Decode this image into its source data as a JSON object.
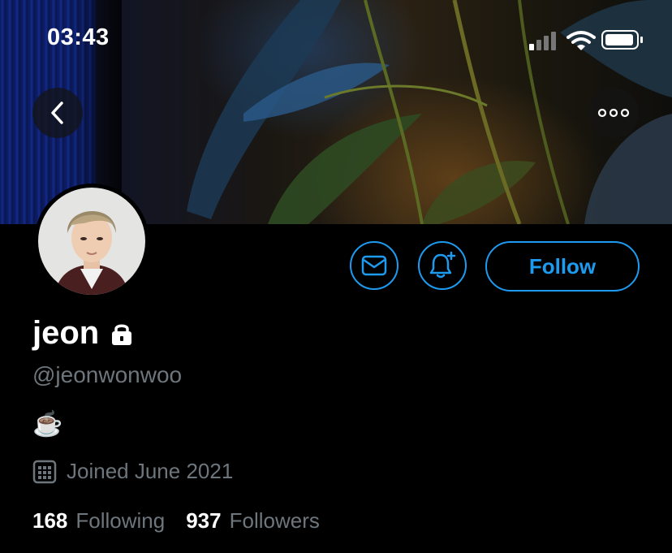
{
  "status_bar": {
    "time": "03:43",
    "signal_icon": "cellular-signal-icon",
    "wifi_icon": "wifi-icon",
    "battery_icon": "battery-icon"
  },
  "header": {
    "back_icon": "chevron-left-icon",
    "more_icon": "more-horizontal-icon"
  },
  "actions": {
    "message_icon": "envelope-icon",
    "notify_icon": "bell-plus-icon",
    "follow_label": "Follow"
  },
  "profile": {
    "display_name": "jeon",
    "locked_icon": "lock-icon",
    "handle": "@jeonwonwoo",
    "bio": "☕️",
    "joined_icon": "calendar-icon",
    "joined": "Joined June 2021"
  },
  "stats": {
    "following_count": "168",
    "following_label": "Following",
    "followers_count": "937",
    "followers_label": "Followers"
  },
  "colors": {
    "accent": "#1d9bf0",
    "secondary_text": "#6e767d",
    "background": "#000000"
  }
}
